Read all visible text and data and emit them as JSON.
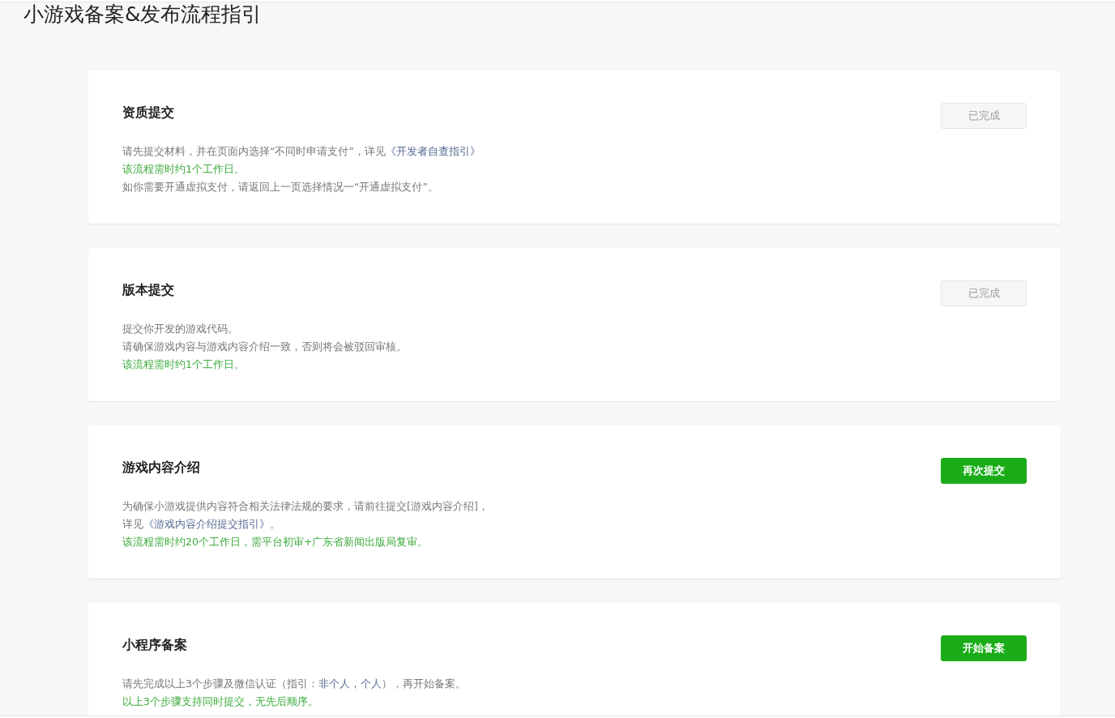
{
  "page_title": "小游戏备案&发布流程指引",
  "steps": [
    {
      "title": "资质提交",
      "button": {
        "label": "已完成",
        "disabled": true
      },
      "lines": [
        {
          "kind": "plain",
          "parts": [
            {
              "text": "请先提交材料，并在页面内选择“不同时申请支付”，详见",
              "link": false
            },
            {
              "text": "《开发者自查指引》",
              "link": true
            }
          ]
        },
        {
          "kind": "note",
          "parts": [
            {
              "text": "该流程需时约1个工作日。",
              "link": false
            }
          ]
        },
        {
          "kind": "plain",
          "parts": [
            {
              "text": "如你需要开通虚拟支付，请返回上一页选择情况一“开通虚拟支付”。",
              "link": false
            }
          ]
        }
      ]
    },
    {
      "title": "版本提交",
      "button": {
        "label": "已完成",
        "disabled": true
      },
      "lines": [
        {
          "kind": "plain",
          "parts": [
            {
              "text": "提交你开发的游戏代码。",
              "link": false
            }
          ]
        },
        {
          "kind": "plain",
          "parts": [
            {
              "text": "请确保游戏内容与游戏内容介绍一致，否则将会被驳回审核。",
              "link": false
            }
          ]
        },
        {
          "kind": "note",
          "parts": [
            {
              "text": "该流程需时约1个工作日。",
              "link": false
            }
          ]
        }
      ]
    },
    {
      "title": "游戏内容介绍",
      "button": {
        "label": "再次提交",
        "disabled": false
      },
      "lines": [
        {
          "kind": "plain",
          "parts": [
            {
              "text": "为确保小游戏提供内容符合相关法律法规的要求，请前往提交[游戏内容介绍]，",
              "link": false
            }
          ]
        },
        {
          "kind": "plain",
          "parts": [
            {
              "text": "详见",
              "link": false
            },
            {
              "text": "《游戏内容介绍提交指引》",
              "link": true
            },
            {
              "text": "。",
              "link": false
            }
          ]
        },
        {
          "kind": "note",
          "parts": [
            {
              "text": "该流程需时约20个工作日，需平台初审+广东省新闻出版局复审。",
              "link": false
            }
          ]
        }
      ]
    },
    {
      "title": "小程序备案",
      "button": {
        "label": "开始备案",
        "disabled": false
      },
      "lines": [
        {
          "kind": "plain",
          "parts": [
            {
              "text": "请先完成以上3个步骤及微信认证（指引：",
              "link": false
            },
            {
              "text": "非个人，",
              "link": true
            },
            {
              "text": "个人",
              "link": true
            },
            {
              "text": "），再开始备案。",
              "link": false
            }
          ]
        },
        {
          "kind": "note",
          "parts": [
            {
              "text": "以上3个步骤支持同时提交，无先后顺序。",
              "link": false
            }
          ]
        }
      ]
    }
  ]
}
